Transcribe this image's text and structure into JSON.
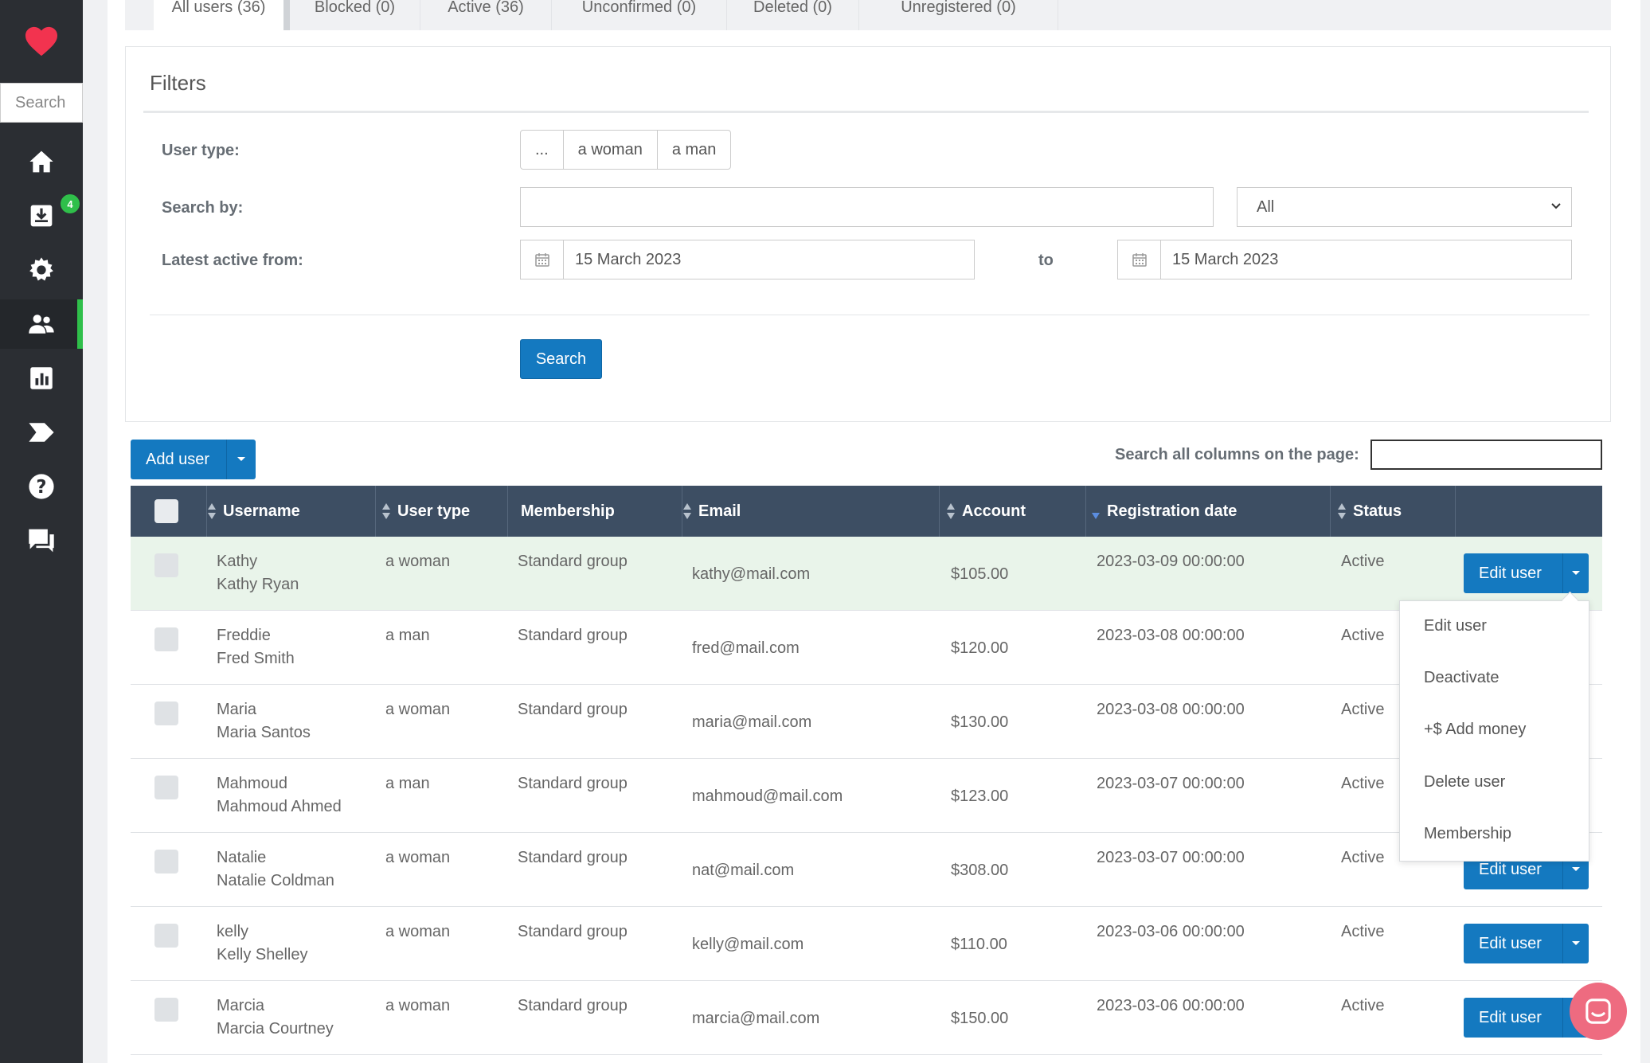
{
  "sidebar": {
    "search_placeholder": "Search",
    "notification_badge": "4",
    "items": [
      {
        "icon": "home-icon"
      },
      {
        "icon": "inbox-download-icon"
      },
      {
        "icon": "gear-icon"
      },
      {
        "icon": "users-icon",
        "active": true
      },
      {
        "icon": "bar-chart-icon"
      },
      {
        "icon": "tag-arrow-icon"
      },
      {
        "icon": "help-icon"
      },
      {
        "icon": "chat-icon"
      }
    ]
  },
  "tabs": [
    {
      "label": "All users (36)",
      "active": true
    },
    {
      "label": "Blocked (0)"
    },
    {
      "label": "Active (36)"
    },
    {
      "label": "Unconfirmed (0)"
    },
    {
      "label": "Deleted (0)"
    },
    {
      "label": "Unregistered (0)"
    }
  ],
  "filters": {
    "title": "Filters",
    "user_type_label": "User type:",
    "user_type_options": [
      "...",
      "a woman",
      "a man"
    ],
    "search_by_label": "Search by:",
    "search_by_value": "",
    "search_by_select": "All",
    "latest_active_label": "Latest active from:",
    "date_from": "15 March 2023",
    "to_label": "to",
    "date_to": "15 March 2023",
    "search_button": "Search"
  },
  "toolbar": {
    "add_user": "Add user",
    "search_all_label": "Search all columns on the page:"
  },
  "table": {
    "headers": {
      "username": "Username",
      "user_type": "User type",
      "membership": "Membership",
      "email": "Email",
      "account": "Account",
      "registration_date": "Registration date",
      "status": "Status"
    },
    "edit_label": "Edit user",
    "rows": [
      {
        "username": "Kathy",
        "fullname": "Kathy Ryan",
        "type": "a woman",
        "membership": "Standard group",
        "email": "kathy@mail.com",
        "account": "$105.00",
        "date": "2023-03-09 00:00:00",
        "status": "Active"
      },
      {
        "username": "Freddie",
        "fullname": "Fred Smith",
        "type": "a man",
        "membership": "Standard group",
        "email": "fred@mail.com",
        "account": "$120.00",
        "date": "2023-03-08 00:00:00",
        "status": "Active"
      },
      {
        "username": "Maria",
        "fullname": "Maria Santos",
        "type": "a woman",
        "membership": "Standard group",
        "email": "maria@mail.com",
        "account": "$130.00",
        "date": "2023-03-08 00:00:00",
        "status": "Active"
      },
      {
        "username": "Mahmoud",
        "fullname": "Mahmoud Ahmed",
        "type": "a man",
        "membership": "Standard group",
        "email": "mahmoud@mail.com",
        "account": "$123.00",
        "date": "2023-03-07 00:00:00",
        "status": "Active"
      },
      {
        "username": "Natalie",
        "fullname": "Natalie Coldman",
        "type": "a woman",
        "membership": "Standard group",
        "email": "nat@mail.com",
        "account": "$308.00",
        "date": "2023-03-07 00:00:00",
        "status": "Active"
      },
      {
        "username": "kelly",
        "fullname": "Kelly Shelley",
        "type": "a woman",
        "membership": "Standard group",
        "email": "kelly@mail.com",
        "account": "$110.00",
        "date": "2023-03-06 00:00:00",
        "status": "Active"
      },
      {
        "username": "Marcia",
        "fullname": "Marcia Courtney",
        "type": "a woman",
        "membership": "Standard group",
        "email": "marcia@mail.com",
        "account": "$150.00",
        "date": "2023-03-06 00:00:00",
        "status": "Active"
      }
    ]
  },
  "dropdown": {
    "items": [
      "Edit user",
      "Deactivate",
      "+$ Add money",
      "Delete user",
      "Membership"
    ]
  },
  "colors": {
    "primary": "#1479c0",
    "sidebar": "#2b2e33",
    "table_header": "#3d4e63",
    "active_accent": "#2fbf4a",
    "highlight_row": "#e9f4ea",
    "chat_bubble": "#ee6b80",
    "logo_heart": "#f2334f"
  }
}
